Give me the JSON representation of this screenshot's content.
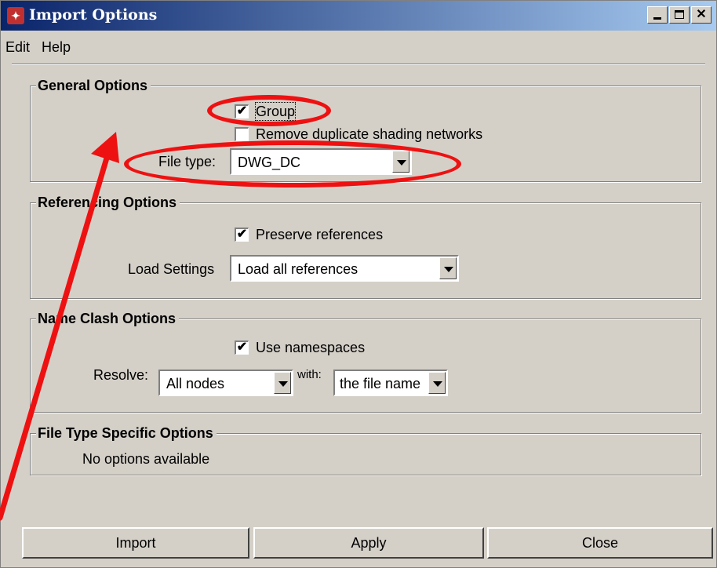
{
  "window": {
    "title": "Import Options",
    "controls": {
      "close_glyph": "✕"
    }
  },
  "menu": [
    {
      "label": "Edit"
    },
    {
      "label": "Help"
    }
  ],
  "general_options": {
    "title": "General Options",
    "group_label": "Group",
    "group_checked": true,
    "remove_duplicate_label": "Remove duplicate shading networks",
    "remove_duplicate_checked": false,
    "file_type_label": "File type:",
    "file_type_value": "DWG_DC"
  },
  "referencing_options": {
    "title": "Referencing Options",
    "preserve_label": "Preserve references",
    "preserve_checked": true,
    "load_settings_label": "Load Settings",
    "load_settings_value": "Load all references"
  },
  "name_clash_options": {
    "title": "Name Clash Options",
    "namespaces_label": "Use namespaces",
    "namespaces_checked": true,
    "resolve_label": "Resolve:",
    "resolve_value": "All nodes",
    "with_label": "with:",
    "with_value": "the file name"
  },
  "file_type_specific": {
    "title": "File Type Specific Options",
    "message": "No options available"
  },
  "buttons": {
    "import": "Import",
    "apply": "Apply",
    "close": "Close"
  },
  "annotation_color": "#ee1111",
  "check_mark": "✔"
}
